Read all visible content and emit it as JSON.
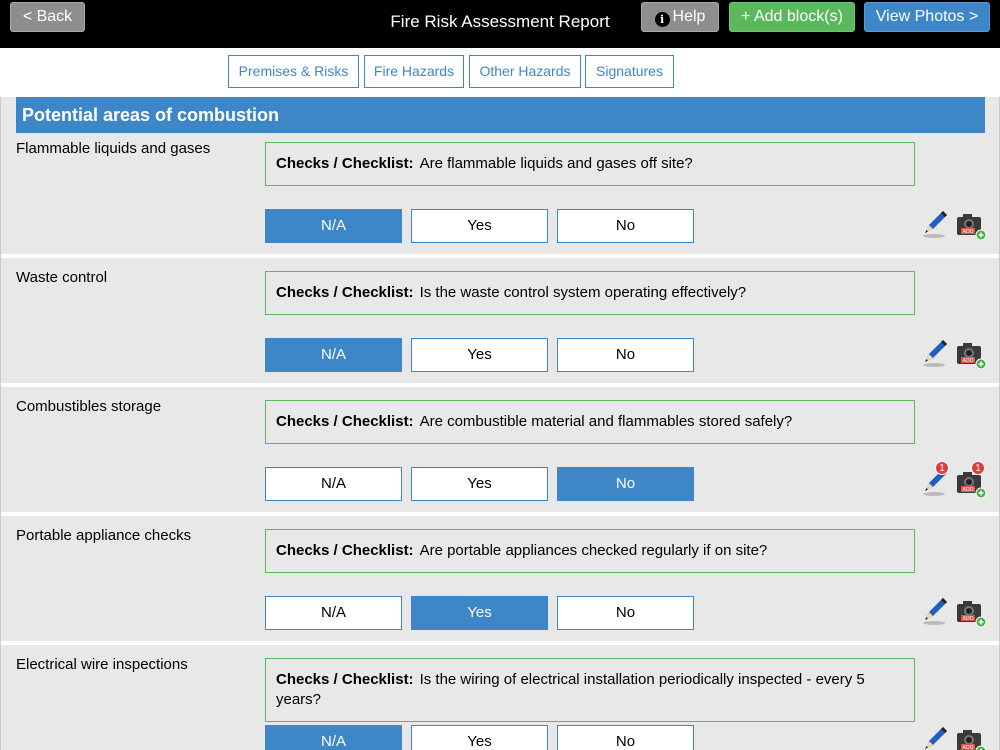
{
  "topbar": {
    "back_label": "< Back",
    "title": "Fire Risk Assessment Report",
    "help_label": "Help",
    "add_label": "+ Add block(s)",
    "photos_label": "View Photos >"
  },
  "tabs": [
    "Premises & Risks",
    "Fire Hazards",
    "Other Hazards",
    "Signatures"
  ],
  "section": {
    "title": "Potential areas of combustion"
  },
  "checklist_prefix": "Checks / Checklist:",
  "options": [
    "N/A",
    "Yes",
    "No"
  ],
  "rows": [
    {
      "label": "Flammable liquids and gases",
      "question": "Are flammable liquids and gases off site?",
      "selected": "N/A",
      "notes_count": "",
      "photos_count": ""
    },
    {
      "label": "Waste control",
      "question": "Is the waste control system operating effectively?",
      "selected": "N/A",
      "notes_count": "",
      "photos_count": ""
    },
    {
      "label": "Combustibles storage",
      "question": "Are combustible material and flammables stored safely?",
      "selected": "No",
      "notes_count": "1",
      "photos_count": "1"
    },
    {
      "label": "Portable appliance checks",
      "question": "Are portable appliances checked regularly if on site?",
      "selected": "Yes",
      "notes_count": "",
      "photos_count": ""
    },
    {
      "label": "Electrical wire inspections",
      "question": "Is the wiring of electrical installation periodically inspected - every 5 years?",
      "selected": "N/A",
      "notes_count": "",
      "photos_count": ""
    }
  ],
  "icons": {
    "pencil": "pencil-icon",
    "camera": "camera-add-icon"
  },
  "colors": {
    "accent": "#3d87c9",
    "add_green": "#5cb85c",
    "badge_red": "#e23b3b"
  }
}
